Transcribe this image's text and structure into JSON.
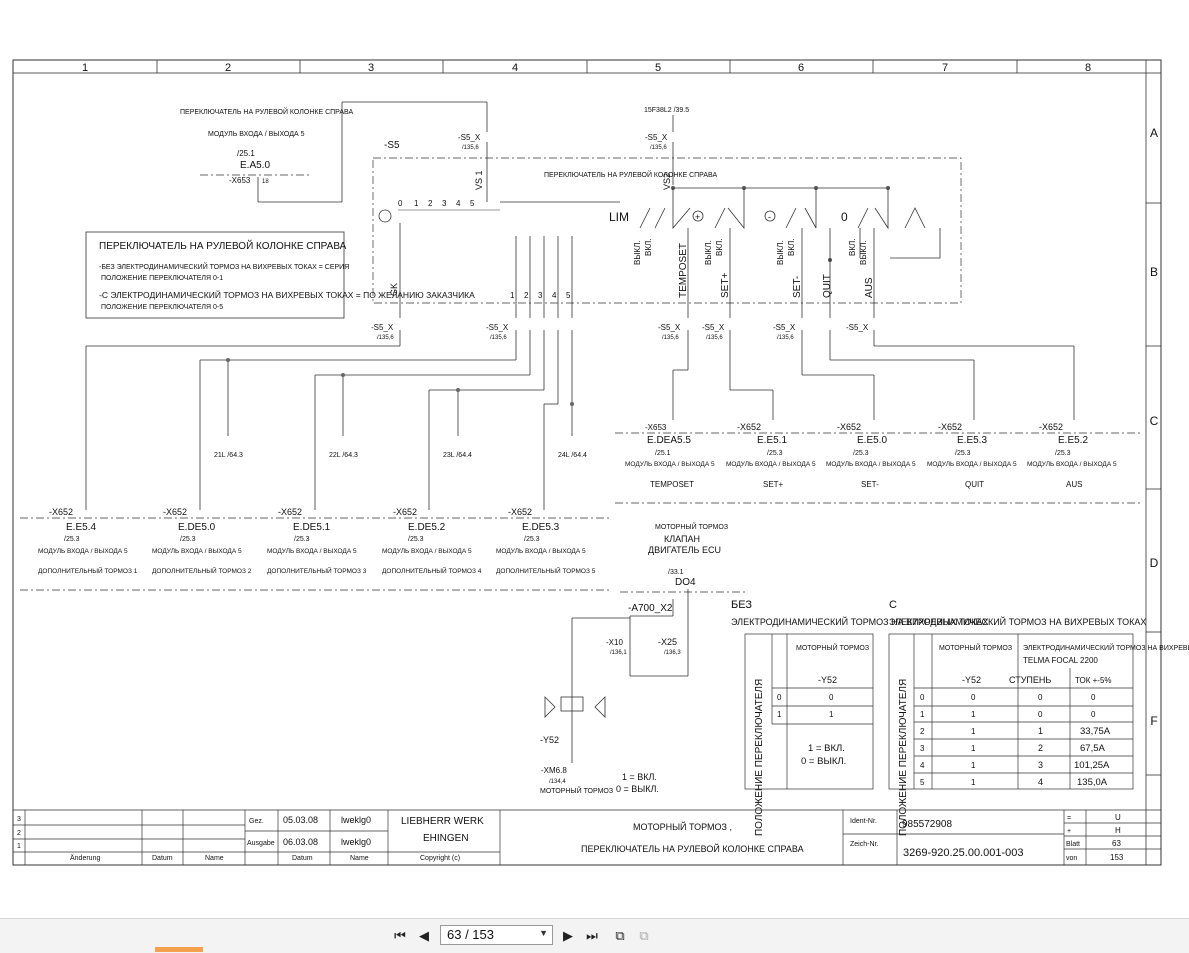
{
  "grid": {
    "columns": [
      "1",
      "2",
      "3",
      "4",
      "5",
      "6",
      "7",
      "8"
    ],
    "rows": [
      "A",
      "B",
      "C",
      "D",
      "E",
      "F"
    ]
  },
  "schematic": {
    "top_note_1": "ПЕРЕКЛЮЧАТЕЛЬ НА РУЛЕВОЙ КОЛОНКЕ СПРАВА",
    "top_note_2": "МОДУЛЬ ВХОДА / ВЫХОДА 5",
    "ea50_ref": "/25.1",
    "ea50": "E.A5.0",
    "x653_18": "-X653",
    "ref_39_5": "15F38L2  /39.5",
    "s5": "-S5",
    "vs1": "VS 1",
    "vs2": "VS2",
    "inner_note": "ПЕРЕКЛЮЧАТЕЛЬ НА РУЛЕВОЙ КОЛОНКЕ СПРАВА",
    "lim": "LIM",
    "vykl": "ВЫКЛ.",
    "vkl": "ВКЛ.",
    "plus_sign": "+",
    "minus_sign": "-",
    "zero": "0",
    "gk": "GK",
    "box": {
      "title": "ПЕРЕКЛЮЧАТЕЛЬ НА РУЛЕВОЙ КОЛОНКЕ СПРАВА",
      "line1": "-БЕЗ ЭЛЕКТРОДИНАМИЧЕСКИЙ ТОРМОЗ НА ВИХРЕВЫХ ТОКАХ = СЕРИЯ",
      "line2": "ПОЛОЖЕНИЕ ПЕРЕКЛЮЧАТЕЛЯ 0-1",
      "line3": "-C ЭЛЕКТРОДИНАМИЧЕСКИЙ ТОРМОЗ НА ВИХРЕВЫХ ТОКАХ = ПО ЖЕЛАНИЮ ЗАКАЗЧИКА",
      "line4": "ПОЛОЖЕНИЕ ПЕРЕКЛЮЧАТЕЛЯ 0-5"
    },
    "switch_labels": [
      "TEMPOSET",
      "SET+",
      "SET-",
      "QUIT",
      "AUS"
    ],
    "s5x": "-S5_X",
    "ref_135_6": "/135,6",
    "refs_64": [
      "21L   /64.3",
      "22L   /64.3",
      "23L   /64.4",
      "24L   /64.4"
    ],
    "upper_modules": [
      {
        "conn": "-X653",
        "pin": "7",
        "name": "E.DEA5.5",
        "ref": "/25.1",
        "mod": "МОДУЛЬ ВХОДА / ВЫХОДА 5",
        "fn": "TEMPOSET"
      },
      {
        "conn": "-X652",
        "pin": "15",
        "name": "E.E5.1",
        "ref": "/25.3",
        "mod": "МОДУЛЬ ВХОДА / ВЫХОДА 5",
        "fn": "SET+"
      },
      {
        "conn": "-X652",
        "pin": "17",
        "name": "E.E5.0",
        "ref": "/25.3",
        "mod": "МОДУЛЬ ВХОДА / ВЫХОДА 5",
        "fn": "SET-"
      },
      {
        "conn": "-X652",
        "pin": "11",
        "name": "E.E5.3",
        "ref": "/25.3",
        "mod": "МОДУЛЬ ВХОДА / ВЫХОДА 5",
        "fn": "QUIT"
      },
      {
        "conn": "-X652",
        "pin": "13",
        "name": "E.E5.2",
        "ref": "/25.3",
        "mod": "МОДУЛЬ ВХОДА / ВЫХОДА 5",
        "fn": "AUS"
      }
    ],
    "lower_modules": [
      {
        "conn": "-X652",
        "pin": "9",
        "name": "E.E5.4",
        "ref": "/25.3",
        "mod": "МОДУЛЬ ВХОДА / ВЫХОДА 5",
        "fn": "ДОПОЛНИТЕЛЬНЫЙ ТОРМОЗ 1"
      },
      {
        "conn": "-X652",
        "pin": "18",
        "name": "E.DE5.0",
        "ref": "/25.3",
        "mod": "МОДУЛЬ ВХОДА / ВЫХОДА 5",
        "fn": "ДОПОЛНИТЕЛЬНЫЙ ТОРМОЗ 2"
      },
      {
        "conn": "-X652",
        "pin": "16",
        "name": "E.DE5.1",
        "ref": "/25.3",
        "mod": "МОДУЛЬ ВХОДА / ВЫХОДА 5",
        "fn": "ДОПОЛНИТЕЛЬНЫЙ ТОРМОЗ 3"
      },
      {
        "conn": "-X652",
        "pin": "14",
        "name": "E.DE5.2",
        "ref": "/25.3",
        "mod": "МОДУЛЬ ВХОДА / ВЫХОДА 5",
        "fn": "ДОПОЛНИТЕЛЬНЫЙ ТОРМОЗ 4"
      },
      {
        "conn": "-X652",
        "pin": "12",
        "name": "E.DE5.3",
        "ref": "/25.3",
        "mod": "МОДУЛЬ ВХОДА / ВЫХОДА 5",
        "fn": "ДОПОЛНИТЕЛЬНЫЙ ТОРМОЗ 5"
      }
    ],
    "motor_brake": "МОТОРНЫЙ ТОРМОЗ",
    "valve": "КЛАПАН",
    "engine_ecu": "ДВИГАТЕЛЬ ECU",
    "ref_33_1": "/33.1",
    "do4": "DO4",
    "a700": "-A700_X2",
    "x10": "-X10",
    "x10_ref": "/136,1",
    "x25": "-X25",
    "x25_ref": "/136,3",
    "y52": "-Y52",
    "xm68": "-XM6.8",
    "xm68_ref": "/134,4",
    "legend_on": "1 = ВКЛ.",
    "legend_off": "0 = ВЫКЛ."
  },
  "table_without": {
    "heading_a": "БЕЗ",
    "heading_b": "ЭЛЕКТРОДИНАМИЧЕСКИЙ ТОРМОЗ НА ВИХРЕВЫХ ТОКАХ",
    "vertical": "ПОЛОЖЕНИЕ ПЕРЕКЛЮЧАТЕЛЯ",
    "col_header": "МОТОРНЫЙ ТОРМОЗ",
    "col_sub": "-Y52",
    "rows": [
      [
        "0",
        "0"
      ],
      [
        "1",
        "1"
      ]
    ],
    "legend_on": "1 = ВКЛ.",
    "legend_off": "0 = ВЫКЛ."
  },
  "table_with": {
    "heading_a": "C",
    "heading_b": "ЭЛЕКТРОДИНАМИЧЕСКИЙ ТОРМОЗ НА ВИХРЕВЫХ ТОКАХ",
    "vertical": "ПОЛОЖЕНИЕ ПЕРЕКЛЮЧАТЕЛЯ",
    "col1": "МОТОРНЫЙ ТОРМОЗ",
    "col2": "ЭЛЕКТРОДИНАМИЧЕСКИЙ ТОРМОЗ НА ВИХРЕВЫХ Т",
    "col2b": "TELMA FOCAL 2200",
    "sub1": "-Y52",
    "sub2": "СТУПЕНЬ",
    "sub3": "ТОК +-5%",
    "rows": [
      [
        "0",
        "0",
        "0",
        "0"
      ],
      [
        "1",
        "1",
        "0",
        "0"
      ],
      [
        "2",
        "1",
        "1",
        "33,75A"
      ],
      [
        "3",
        "1",
        "2",
        "67,5A"
      ],
      [
        "4",
        "1",
        "3",
        "101,25A"
      ],
      [
        "5",
        "1",
        "4",
        "135,0A"
      ]
    ]
  },
  "title_block": {
    "rev_rows": [
      "3",
      "2",
      "1"
    ],
    "cols": [
      "Änderung",
      "Datum",
      "Name"
    ],
    "gez": "Gez.",
    "gez_date": "05.03.08",
    "gez_name": "lweklg0",
    "ausgabe": "Ausgabe",
    "ausgabe_date": "06.03.08",
    "ausgabe_name": "lweklg0",
    "datum": "Datum",
    "name": "Name",
    "company_1": "LIEBHERR WERK",
    "company_2": "EHINGEN",
    "copyright": "Copyright (c)",
    "title_1": "МОТОРНЫЙ ТОРМОЗ ,",
    "title_2": "ПЕРЕКЛЮЧАТЕЛЬ НА РУЛЕВОЙ КОЛОНКЕ СПРАВА",
    "ident_label": "Ident-Nr.",
    "ident": "985572908",
    "zeich_label": "Zeich-Nr.",
    "zeich": "3269-920.25.00.001-003",
    "eq": "=",
    "eq_val": "U",
    "plus": "+",
    "plus_val": "H",
    "blatt": "Blatt",
    "blatt_val": "63",
    "von": "von",
    "von_val": "153"
  },
  "viewer": {
    "page_field": "63 / 153"
  }
}
